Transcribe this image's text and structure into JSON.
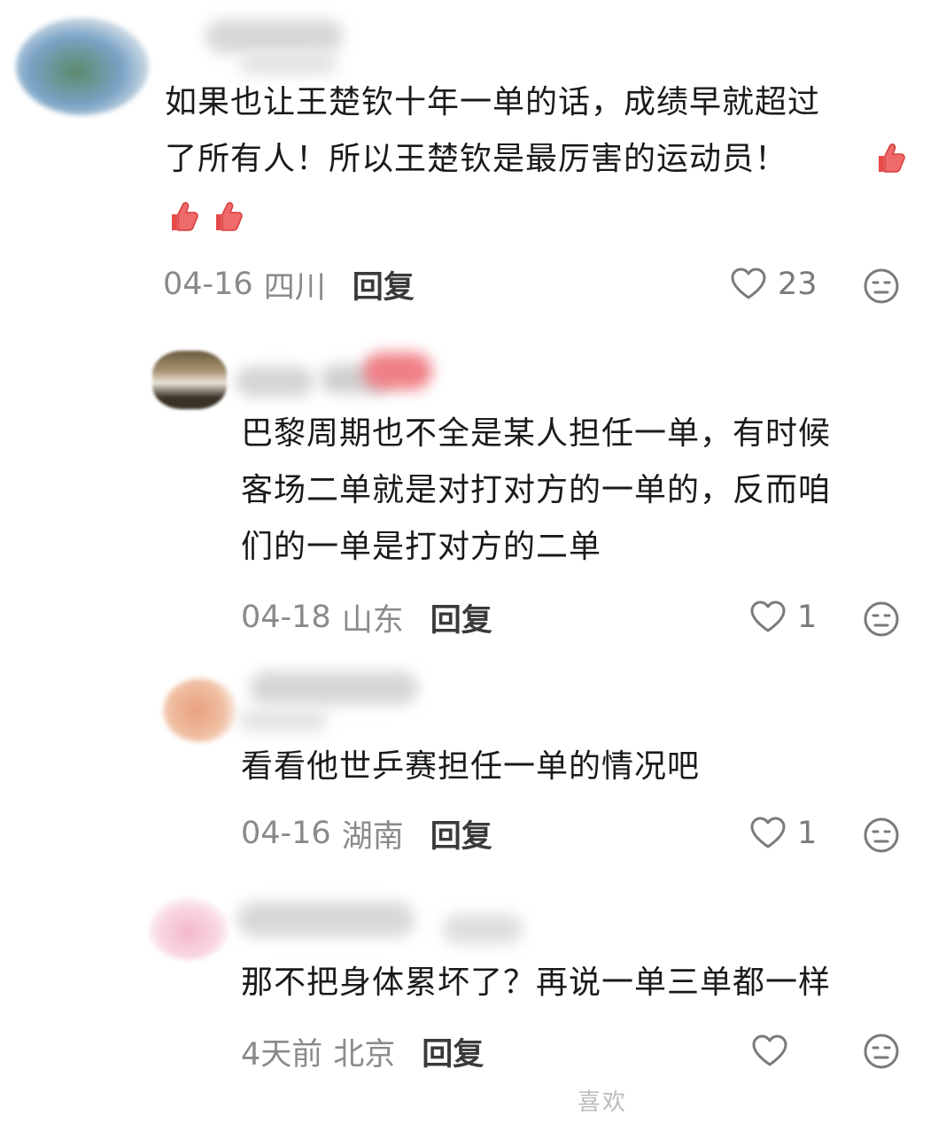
{
  "comments": [
    {
      "text_lines": [
        "如果也让王楚钦十年一单的话，成绩早就超过",
        "了所有人！所以王楚钦是最厉害的运动员！"
      ],
      "emoji": "thumbs-up",
      "date": "04-16",
      "region": "四川",
      "reply_label": "回复",
      "like_count": "23"
    },
    {
      "text_lines": [
        "巴黎周期也不全是某人担任一单，有时候",
        "客场二单就是对打对方的一单的，反而咱",
        "们的一单是打对方的二单"
      ],
      "date": "04-18",
      "region": "山东",
      "reply_label": "回复",
      "like_count": "1"
    },
    {
      "text_lines": [
        "看看他世乒赛担任一单的情况吧"
      ],
      "date": "04-16",
      "region": "湖南",
      "reply_label": "回复",
      "like_count": "1"
    },
    {
      "text_lines": [
        "那不把身体累坏了？再说一单三单都一样"
      ],
      "date": "4天前",
      "region": "北京",
      "reply_label": "回复",
      "like_count": ""
    }
  ],
  "watermark": "喜欢",
  "colors": {
    "text": "#1a1a1a",
    "meta": "#8a8a8a",
    "reply": "#3a3a3a",
    "icon": "#7a7a7a",
    "emoji": "#e84a4a"
  }
}
